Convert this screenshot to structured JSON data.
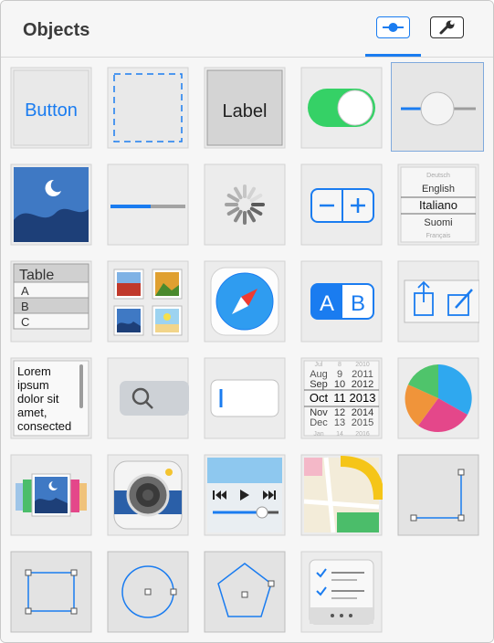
{
  "header": {
    "title": "Objects",
    "tabs": [
      {
        "name": "objects-library",
        "icon": "slider-icon",
        "active": true
      },
      {
        "name": "attributes",
        "icon": "wrench-icon",
        "active": false
      }
    ]
  },
  "library": {
    "button_label": "Button",
    "label_label": "Label",
    "picker_items": [
      "Deutsch",
      "English",
      "Italiano",
      "Suomi",
      "Français"
    ],
    "table_header": "Table",
    "table_rows": [
      "A",
      "B",
      "C"
    ],
    "textview_lines": [
      "Lorem",
      "ipsum",
      "dolor sit",
      "amet,",
      "consected"
    ],
    "segment_labels": [
      "A",
      "B"
    ],
    "datepicker_rows": [
      {
        "month": "Jul",
        "day": "8",
        "year": "2010"
      },
      {
        "month": "Aug",
        "day": "9",
        "year": "2011"
      },
      {
        "month": "Sep",
        "day": "10",
        "year": "2012"
      },
      {
        "month": "Oct",
        "day": "11",
        "year": "2013"
      },
      {
        "month": "Nov",
        "day": "12",
        "year": "2014"
      },
      {
        "month": "Dec",
        "day": "13",
        "year": "2015"
      },
      {
        "month": "Jan",
        "day": "14",
        "year": "2016"
      }
    ]
  },
  "colors": {
    "accent": "#1a7cf0",
    "switch_on": "#35d166",
    "tile_bg": "#eeeeee"
  }
}
